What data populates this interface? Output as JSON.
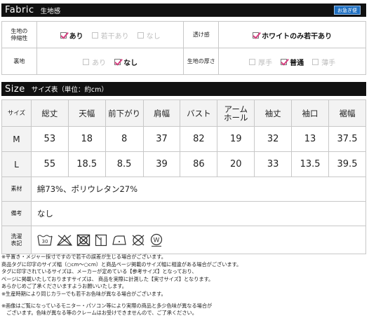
{
  "fabric_section": {
    "title_en": "Fabric",
    "title_jp": "生地感",
    "badge": "お急ぎ便",
    "rows": [
      {
        "left_label_lines": [
          "生地の",
          "伸縮性"
        ],
        "left_options": [
          {
            "label": "あり",
            "checked": true
          },
          {
            "label": "若干あり",
            "checked": false
          },
          {
            "label": "なし",
            "checked": false
          }
        ],
        "right_label": "透け感",
        "right_options": [
          {
            "label": "ホワイトのみ若干あり",
            "checked": true
          }
        ]
      },
      {
        "left_label_lines": [
          "裏地"
        ],
        "left_options": [
          {
            "label": "あり",
            "checked": false
          },
          {
            "label": "なし",
            "checked": true
          }
        ],
        "right_label": "生地の厚さ",
        "right_options": [
          {
            "label": "厚手",
            "checked": false
          },
          {
            "label": "普通",
            "checked": true
          },
          {
            "label": "薄手",
            "checked": false
          }
        ]
      }
    ]
  },
  "size_section": {
    "title_en": "Size",
    "title_jp": "サイズ表（単位：約cm）",
    "corner_label": "サイズ",
    "columns": [
      "総丈",
      "天幅",
      "前下がり",
      "肩幅",
      "バスト",
      "アーム\nホール",
      "袖丈",
      "袖口",
      "裾幅"
    ],
    "rows": [
      {
        "size": "M",
        "values": [
          "53",
          "18",
          "8",
          "37",
          "82",
          "19",
          "32",
          "13",
          "37.5"
        ]
      },
      {
        "size": "L",
        "values": [
          "55",
          "18.5",
          "8.5",
          "39",
          "86",
          "20",
          "33",
          "13.5",
          "39.5"
        ]
      }
    ],
    "material_label": "素材",
    "material_value": "綿73%、ポリウレタン27%",
    "note_label": "備考",
    "note_value": "なし",
    "wash_label_lines": [
      "洗濯",
      "表記"
    ],
    "wash_icons": [
      "hand-wash-30-icon",
      "no-bleach-icon",
      "no-tumble-dry-icon",
      "dry-in-shade-icon",
      "low-iron-icon",
      "no-dry-clean-icon",
      "wet-clean-icon"
    ],
    "wash_temp": "30",
    "wet_clean_letter": "W"
  },
  "notes": [
    "※平置き・メジャー採寸ですので若干の誤差が生じる場合がございます。",
    "商品タグに印字のサイズ幅（○cm〜○cm）と商品ページ掲載のサイズ幅に相違がある場合がございます。",
    "タグに印字されているサイズは、メーカーが定めている【参考サイズ】となっており、",
    "ページに掲載いたしておりますサイズは、 商品を実際に計測した【実寸サイズ】となります。",
    "あらかじめご了承くださいますようお願いいたします。",
    "※生産時期により同じカラーでも若干お色味が異なる場合がございます。",
    "",
    "※画像はご覧になっているモニター・パソコン等により実際の商品と多少色味が異なる場合が",
    "　ございます。色味が異なる等のクレームはお受けできませんので、ご了承ください。"
  ]
}
